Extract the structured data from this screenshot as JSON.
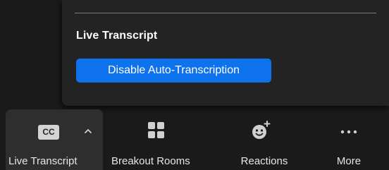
{
  "popup": {
    "title": "Live Transcript",
    "button_label": "Disable Auto-Transcription"
  },
  "toolbar": {
    "items": [
      {
        "label": "Live Transcript",
        "icon": "cc-icon",
        "badge": "CC"
      },
      {
        "label": "Breakout Rooms",
        "icon": "grid-icon"
      },
      {
        "label": "Reactions",
        "icon": "emoji-add-icon"
      },
      {
        "label": "More",
        "icon": "ellipsis-icon"
      }
    ]
  },
  "colors": {
    "background": "#1a1a1a",
    "popup_background": "#232323",
    "accent_button": "#0e72ed",
    "active_tool_background": "#2e2e2e"
  }
}
